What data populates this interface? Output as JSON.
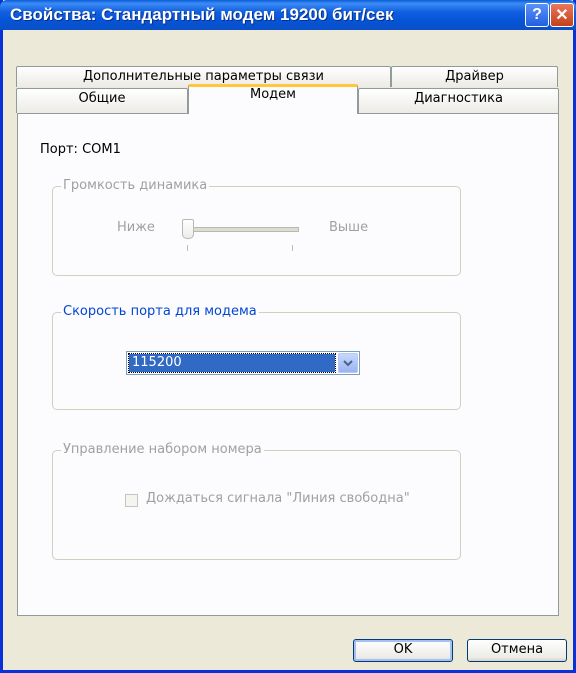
{
  "window": {
    "title": "Свойства: Стандартный модем 19200 бит/сек",
    "help_label": "?",
    "close_label": "✕"
  },
  "tabs": {
    "back_row": [
      "Дополнительные параметры связи",
      "Драйвер"
    ],
    "front_row": [
      "Общие",
      "Модем",
      "Диагностика"
    ],
    "active": "Модем"
  },
  "panel": {
    "port_label": "Порт: COM1",
    "volume": {
      "title": "Громкость динамика",
      "low_label": "Ниже",
      "high_label": "Выше",
      "level": 0
    },
    "port_speed": {
      "title": "Скорость порта для модема",
      "selected": "115200"
    },
    "dial": {
      "title": "Управление набором номера",
      "wait_tone_label": "Дождаться сигнала \"Линия свободна\"",
      "wait_tone_checked": false
    }
  },
  "buttons": {
    "ok_label": "OK",
    "cancel_label": "Отмена"
  },
  "colors": {
    "title_bar": "#0554d6",
    "active_tab_accent": "#ffc73c",
    "selection": "#316ac5",
    "group_title": "#0046d5"
  }
}
